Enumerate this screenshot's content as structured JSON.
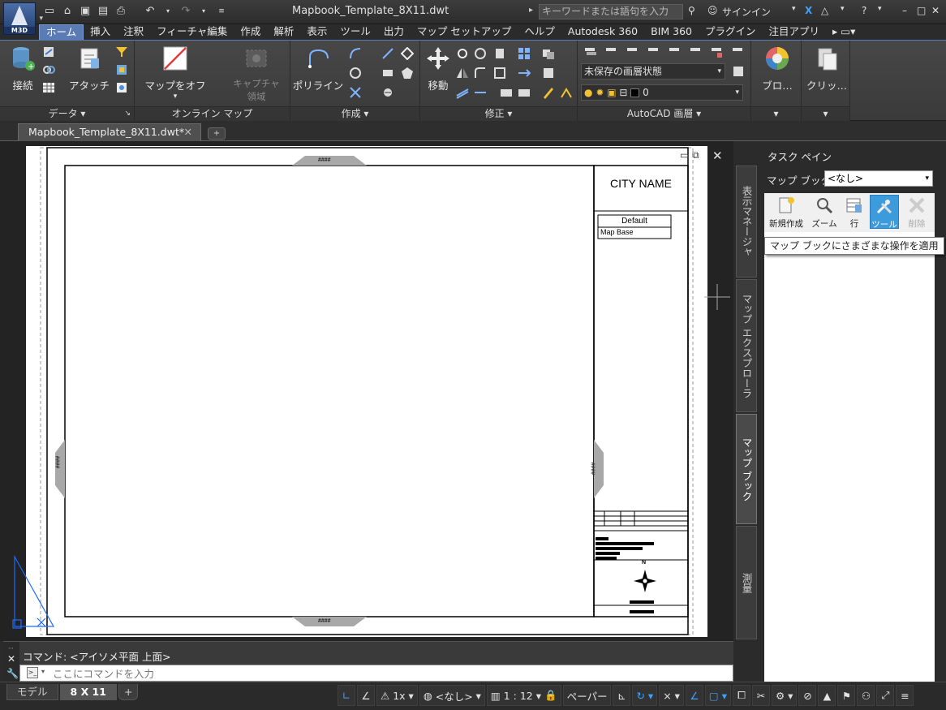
{
  "app": {
    "logo_label": "M3D",
    "doc_title": "Mapbook_Template_8X11.dwt",
    "search_placeholder": "キーワードまたは語句を入力",
    "signin_label": "サインイン"
  },
  "ribbon_tabs": [
    "ホーム",
    "挿入",
    "注釈",
    "フィーチャ編集",
    "作成",
    "解析",
    "表示",
    "ツール",
    "出力",
    "マップ セットアップ",
    "ヘルプ",
    "Autodesk 360",
    "BIM 360",
    "プラグイン",
    "注目アプリ"
  ],
  "ribbon": {
    "panels": {
      "data": {
        "title": "データ",
        "connect_label": "接続",
        "attach_label": "アタッチ"
      },
      "online": {
        "title": "オンライン マップ",
        "map_off_label": "マップをオフ",
        "capture_label_1": "キャプチャ",
        "capture_label_2": "領域"
      },
      "create": {
        "title": "作成",
        "polyline_label": "ポリライン"
      },
      "modify": {
        "title": "修正",
        "move_label": "移動"
      },
      "view": {
        "title": "AutoCAD 画層",
        "view_state": "未保存の画層状態",
        "layer_value": "0"
      },
      "block": {
        "label": "ブロ…"
      },
      "clipboard": {
        "label": "クリッ…"
      }
    }
  },
  "doc_tab": {
    "label": "Mapbook_Template_8X11.dwt*"
  },
  "paper": {
    "city_name": "CITY NAME",
    "legend_header": "Default",
    "legend_row": "Map Base",
    "north_label": "N",
    "marker_text": "####"
  },
  "taskpane": {
    "title": "タスク ペイン",
    "vertical_tabs": [
      "表示マネージャ",
      "マップ エクスプローラ",
      "マップ ブック",
      "測量"
    ],
    "mapbook_label": "マップ ブック",
    "mapbook_value": "<なし>",
    "tools": [
      "新規作成",
      "ズーム",
      "行",
      "ツール",
      "削除"
    ],
    "tooltip": "マップ ブックにさまざまな操作を適用"
  },
  "command": {
    "history": "コマンド:  <アイソメ平面 上面>",
    "placeholder": "ここにコマンドを入力"
  },
  "status": {
    "layout_tabs": [
      "モデル",
      "8 X 11"
    ],
    "scale_factor": "1x",
    "coord_system": "<なし>",
    "scale": "1 : 12",
    "paper_label": "ペーパー"
  },
  "colors": {
    "accent": "#5a7bb4",
    "active_tool": "#3c9bdb",
    "ucs_icon": "#1e6bff"
  }
}
